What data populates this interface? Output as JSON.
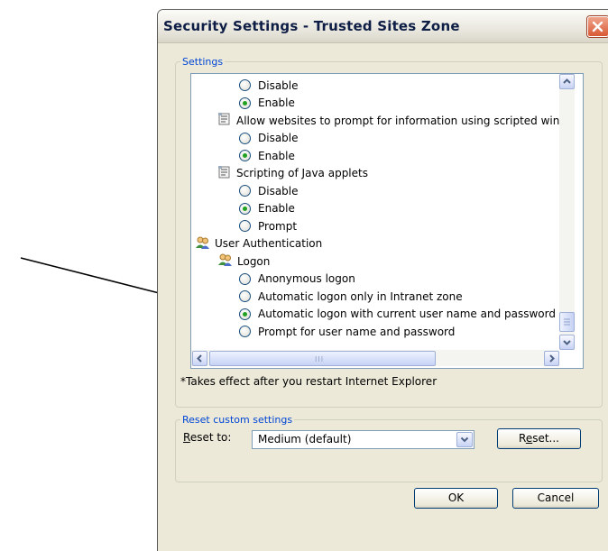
{
  "window": {
    "title": "Security Settings - Trusted Sites Zone"
  },
  "settings": {
    "legend": "Settings",
    "rows": [
      {
        "type": "radio",
        "label": "Disable",
        "checked": false,
        "level": 1
      },
      {
        "type": "radio",
        "label": "Enable",
        "checked": true,
        "level": 1
      },
      {
        "type": "item",
        "icon": "script-icon",
        "label": "Allow websites to prompt for information using scripted windo",
        "level": 0
      },
      {
        "type": "radio",
        "label": "Disable",
        "checked": false,
        "level": 1
      },
      {
        "type": "radio",
        "label": "Enable",
        "checked": true,
        "level": 1
      },
      {
        "type": "item",
        "icon": "script-icon",
        "label": "Scripting of Java applets",
        "level": 0
      },
      {
        "type": "radio",
        "label": "Disable",
        "checked": false,
        "level": 1
      },
      {
        "type": "radio",
        "label": "Enable",
        "checked": true,
        "level": 1
      },
      {
        "type": "radio",
        "label": "Prompt",
        "checked": false,
        "level": 1
      },
      {
        "type": "item",
        "icon": "users-icon",
        "label": "User Authentication",
        "level": -1
      },
      {
        "type": "item",
        "icon": "users-icon",
        "label": "Logon",
        "level": 0
      },
      {
        "type": "radio",
        "label": "Anonymous logon",
        "checked": false,
        "level": 1
      },
      {
        "type": "radio",
        "label": "Automatic logon only in Intranet zone",
        "checked": false,
        "level": 1
      },
      {
        "type": "radio",
        "label": "Automatic logon with current user name and password",
        "checked": true,
        "level": 1
      },
      {
        "type": "radio",
        "label": "Prompt for user name and password",
        "checked": false,
        "level": 1
      }
    ],
    "note": "*Takes effect after you restart Internet Explorer"
  },
  "reset": {
    "legend": "Reset custom settings",
    "label": "Reset to:",
    "selected": "Medium (default)",
    "button": "Reset..."
  },
  "buttons": {
    "ok": "OK",
    "cancel": "Cancel"
  },
  "colors": {
    "legend": "#0046d5",
    "radio_checked": "#21a121",
    "close_button": "#d85a36"
  }
}
